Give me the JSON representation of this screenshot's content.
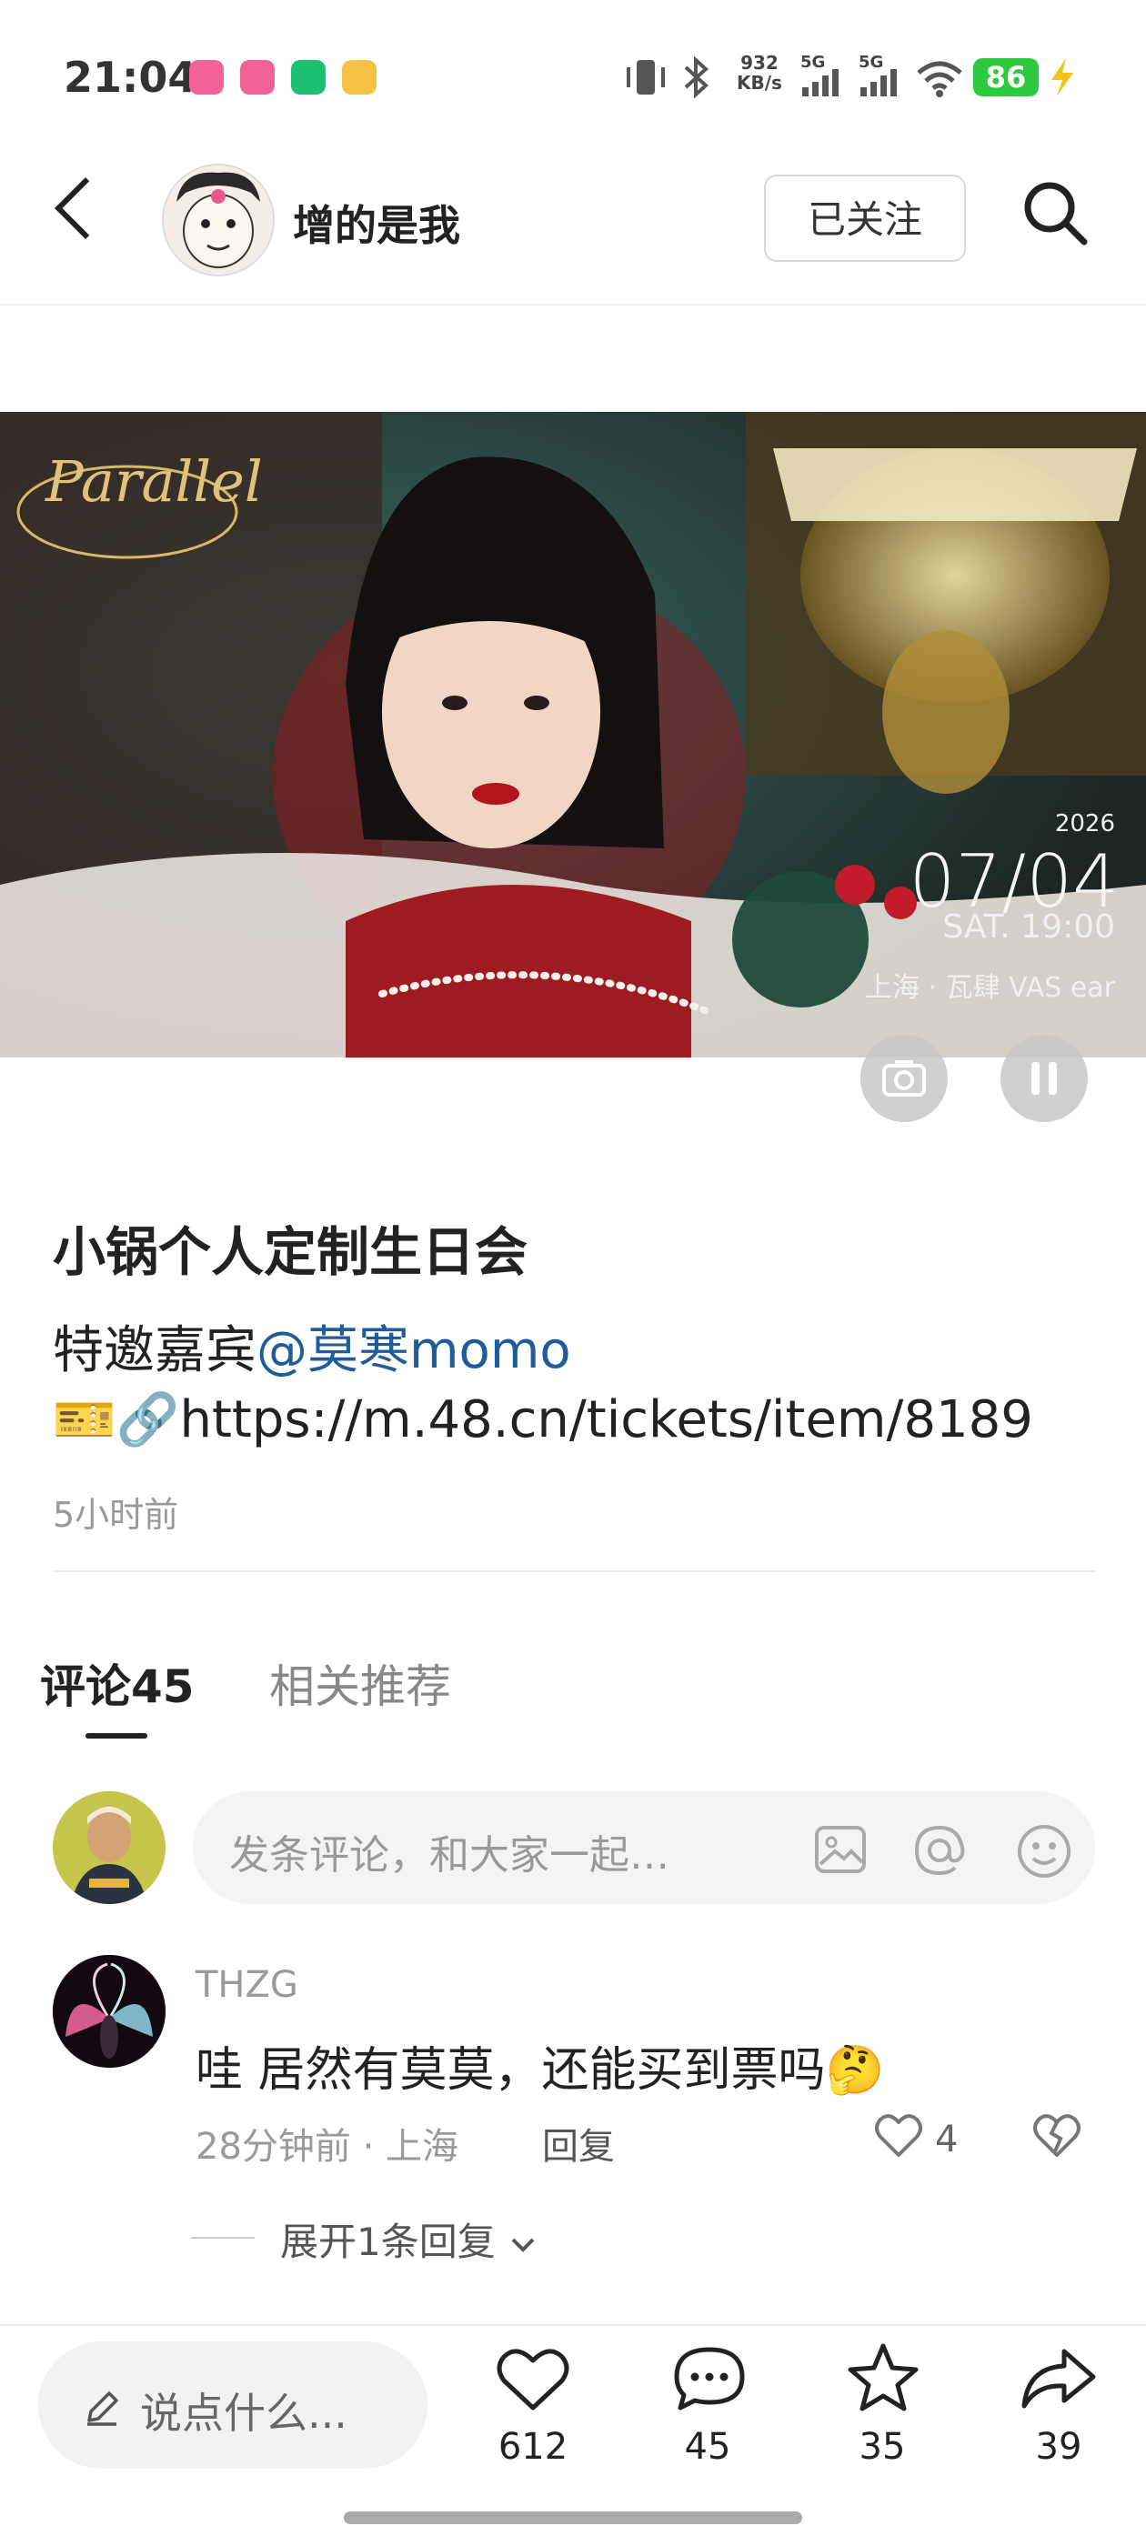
{
  "status_bar": {
    "time": "21:04",
    "network_speed_value": "932",
    "network_speed_unit": "KB/s",
    "sim1": "5G",
    "sim2": "5G",
    "battery": "86",
    "app_icons": [
      "bilibili-icon",
      "bilibili-icon",
      "video-app-icon",
      "weibo-icon"
    ]
  },
  "header": {
    "author_name": "增的是我",
    "follow_label": "已关注"
  },
  "hero_image": {
    "logo_text": "Parallel",
    "year": "2026",
    "date": "07/04",
    "day_time": "SAT. 19:00",
    "venue": "上海 · 瓦肆 VAS ear"
  },
  "post": {
    "title": "小锅个人定制生日会",
    "guest_prefix": "特邀嘉宾",
    "guest_mention": "@莫寒momo",
    "ticket_emoji": "🎫🔗",
    "link": "https://m.48.cn/tickets/item/8189",
    "time": "5小时前"
  },
  "tabs": {
    "comments": "评论45",
    "related": "相关推荐"
  },
  "comment_input": {
    "placeholder": "发条评论，和大家一起…"
  },
  "comments": [
    {
      "user": "THZG",
      "text": "哇 居然有莫莫，还能买到票吗",
      "emoji": "🤔",
      "meta": "28分钟前 · 上海",
      "reply_label": "回复",
      "likes": "4",
      "expand_label": "展开1条回复"
    }
  ],
  "bottom_bar": {
    "say_placeholder": "说点什么...",
    "likes": "612",
    "comments": "45",
    "favorites": "35",
    "shares": "39"
  },
  "colors": {
    "mention": "#1f5c99",
    "battery": "#2fc940",
    "muted_text": "#999999"
  }
}
